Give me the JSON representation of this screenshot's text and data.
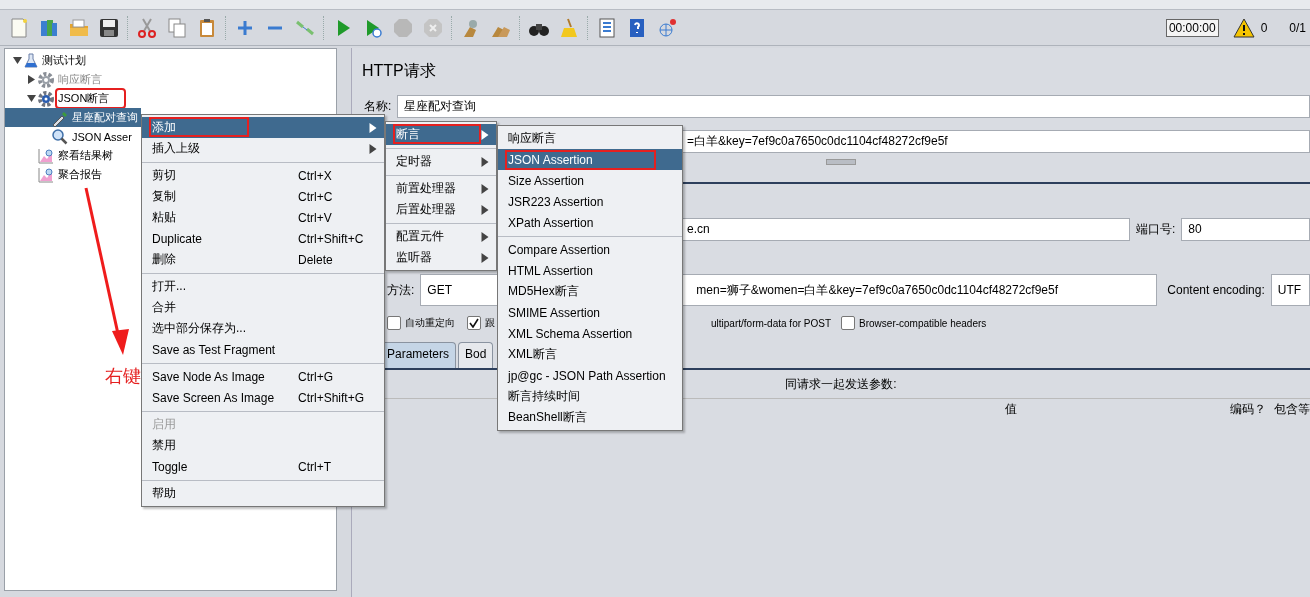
{
  "toolbar": {
    "timer": "00:00:00",
    "warning_count": "0",
    "threads": "0/1"
  },
  "tree": [
    {
      "label": "测试计划",
      "kind": "plan",
      "expanded": true,
      "selected": false,
      "disabled": false,
      "annotated": false,
      "children": [
        {
          "label": "响应断言",
          "kind": "gear",
          "expanded": false,
          "selected": false,
          "disabled": true,
          "annotated": false
        },
        {
          "label": "JSON断言",
          "kind": "gear",
          "expanded": true,
          "selected": false,
          "disabled": false,
          "annotated": true,
          "children": [
            {
              "label": "星座配对查询",
              "kind": "sampler",
              "selected": true,
              "disabled": false,
              "annotated": false
            },
            {
              "label": "JSON Asser",
              "kind": "magnifier",
              "selected": false,
              "disabled": false,
              "annotated": false
            }
          ]
        },
        {
          "label": "察看结果树",
          "kind": "graph",
          "selected": false,
          "disabled": false,
          "annotated": false
        },
        {
          "label": "聚合报告",
          "kind": "graph",
          "selected": false,
          "disabled": false,
          "annotated": false
        }
      ]
    }
  ],
  "form": {
    "title": "HTTP请求",
    "name_label": "名称:",
    "name_value": "星座配对查询",
    "path_value": "=白羊&key=7ef9c0a7650c0dc1104cf48272cf9e5f",
    "server_value": "e.cn",
    "port_label": "端口号:",
    "port_value": "80",
    "method_label": "方法:",
    "method_value": "GET",
    "path2_value": "men=狮子&women=白羊&key=7ef9c0a7650c0dc1104cf48272cf9e5f",
    "encoding_label": "Content encoding:",
    "encoding_value": "UTF",
    "options": [
      {
        "label": "自动重定向",
        "checked": false
      },
      {
        "label": "跟",
        "checked": true
      }
    ],
    "options2": [
      {
        "label": "ultipart/form-data for POST",
        "kind": "text"
      },
      {
        "label": "Browser-compatible headers",
        "kind": "checkbox",
        "checked": false
      }
    ],
    "tabs": [
      {
        "label": "Parameters",
        "selected": true
      },
      {
        "label": "Bod",
        "selected": false
      }
    ],
    "params_title": "同请求一起发送参数:",
    "columns": [
      "值",
      "编码？",
      "包含等"
    ]
  },
  "context_menu": {
    "items": [
      {
        "kind": "submenu",
        "label": "添加",
        "selected": true,
        "annotated": true,
        "disabled": false
      },
      {
        "kind": "submenu",
        "label": "插入上级",
        "selected": false,
        "annotated": false,
        "disabled": false
      },
      {
        "kind": "separator"
      },
      {
        "kind": "item",
        "label": "剪切",
        "shortcut": "Ctrl+X",
        "selected": false,
        "annotated": false,
        "disabled": false
      },
      {
        "kind": "item",
        "label": "复制",
        "shortcut": "Ctrl+C",
        "selected": false,
        "annotated": false,
        "disabled": false
      },
      {
        "kind": "item",
        "label": "粘贴",
        "shortcut": "Ctrl+V",
        "selected": false,
        "annotated": false,
        "disabled": false
      },
      {
        "kind": "item",
        "label": "Duplicate",
        "shortcut": "Ctrl+Shift+C",
        "selected": false,
        "annotated": false,
        "disabled": false
      },
      {
        "kind": "item",
        "label": "删除",
        "shortcut": "Delete",
        "selected": false,
        "annotated": false,
        "disabled": false
      },
      {
        "kind": "separator"
      },
      {
        "kind": "item",
        "label": "打开...",
        "selected": false,
        "annotated": false,
        "disabled": false
      },
      {
        "kind": "item",
        "label": "合并",
        "selected": false,
        "annotated": false,
        "disabled": false
      },
      {
        "kind": "item",
        "label": "选中部分保存为...",
        "selected": false,
        "annotated": false,
        "disabled": false
      },
      {
        "kind": "item",
        "label": "Save as Test Fragment",
        "selected": false,
        "annotated": false,
        "disabled": false
      },
      {
        "kind": "separator"
      },
      {
        "kind": "item",
        "label": "Save Node As Image",
        "shortcut": "Ctrl+G",
        "selected": false,
        "annotated": false,
        "disabled": false
      },
      {
        "kind": "item",
        "label": "Save Screen As Image",
        "shortcut": "Ctrl+Shift+G",
        "selected": false,
        "annotated": false,
        "disabled": false
      },
      {
        "kind": "separator"
      },
      {
        "kind": "item",
        "label": "启用",
        "selected": false,
        "annotated": false,
        "disabled": true
      },
      {
        "kind": "item",
        "label": "禁用",
        "selected": false,
        "annotated": false,
        "disabled": false
      },
      {
        "kind": "item",
        "label": "Toggle",
        "shortcut": "Ctrl+T",
        "selected": false,
        "annotated": false,
        "disabled": false
      },
      {
        "kind": "separator"
      },
      {
        "kind": "item",
        "label": "帮助",
        "selected": false,
        "annotated": false,
        "disabled": false
      }
    ]
  },
  "add_submenu": {
    "items": [
      {
        "kind": "submenu",
        "label": "断言",
        "selected": true,
        "annotated": true,
        "disabled": false
      },
      {
        "kind": "separator"
      },
      {
        "kind": "submenu",
        "label": "定时器",
        "selected": false,
        "annotated": false,
        "disabled": false
      },
      {
        "kind": "separator"
      },
      {
        "kind": "submenu",
        "label": "前置处理器",
        "selected": false,
        "annotated": false,
        "disabled": false
      },
      {
        "kind": "submenu",
        "label": "后置处理器",
        "selected": false,
        "annotated": false,
        "disabled": false
      },
      {
        "kind": "separator"
      },
      {
        "kind": "submenu",
        "label": "配置元件",
        "selected": false,
        "annotated": false,
        "disabled": false
      },
      {
        "kind": "submenu",
        "label": "监听器",
        "selected": false,
        "annotated": false,
        "disabled": false
      }
    ]
  },
  "assertion_submenu": {
    "items": [
      {
        "kind": "item",
        "label": "响应断言",
        "selected": false,
        "annotated": false,
        "disabled": false
      },
      {
        "kind": "item",
        "label": "JSON Assertion",
        "selected": true,
        "annotated": true,
        "disabled": false
      },
      {
        "kind": "item",
        "label": "Size Assertion",
        "selected": false,
        "annotated": false,
        "disabled": false
      },
      {
        "kind": "item",
        "label": "JSR223 Assertion",
        "selected": false,
        "annotated": false,
        "disabled": false
      },
      {
        "kind": "item",
        "label": "XPath Assertion",
        "selected": false,
        "annotated": false,
        "disabled": false
      },
      {
        "kind": "separator"
      },
      {
        "kind": "item",
        "label": "Compare Assertion",
        "selected": false,
        "annotated": false,
        "disabled": false
      },
      {
        "kind": "item",
        "label": "HTML Assertion",
        "selected": false,
        "annotated": false,
        "disabled": false
      },
      {
        "kind": "item",
        "label": "MD5Hex断言",
        "selected": false,
        "annotated": false,
        "disabled": false
      },
      {
        "kind": "item",
        "label": "SMIME Assertion",
        "selected": false,
        "annotated": false,
        "disabled": false
      },
      {
        "kind": "item",
        "label": "XML Schema Assertion",
        "selected": false,
        "annotated": false,
        "disabled": false
      },
      {
        "kind": "item",
        "label": "XML断言",
        "selected": false,
        "annotated": false,
        "disabled": false
      },
      {
        "kind": "item",
        "label": "jp@gc - JSON Path Assertion",
        "selected": false,
        "annotated": false,
        "disabled": false
      },
      {
        "kind": "item",
        "label": "断言持续时间",
        "selected": false,
        "annotated": false,
        "disabled": false
      },
      {
        "kind": "item",
        "label": "BeanShell断言",
        "selected": false,
        "annotated": false,
        "disabled": false
      }
    ]
  },
  "annotation": {
    "label": "右键"
  }
}
